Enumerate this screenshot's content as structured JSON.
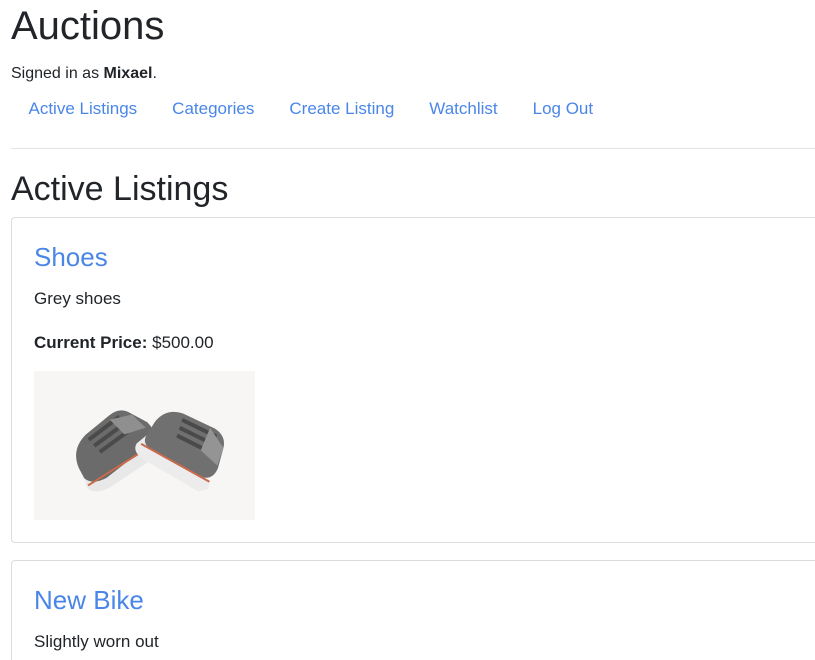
{
  "site": {
    "title": "Auctions",
    "signed_in_prefix": "Signed in as ",
    "username": "Mixael",
    "signed_in_suffix": "."
  },
  "nav": {
    "items": [
      {
        "label": "Active Listings"
      },
      {
        "label": "Categories"
      },
      {
        "label": "Create Listing"
      },
      {
        "label": "Watchlist"
      },
      {
        "label": "Log Out"
      }
    ]
  },
  "main": {
    "heading": "Active Listings",
    "listings": [
      {
        "title": "Shoes",
        "description": "Grey shoes",
        "price_label": "Current Price:",
        "price": "$500.00",
        "image_icon": "sneakers-photo"
      },
      {
        "title": "New Bike",
        "description": "Slightly worn out"
      }
    ]
  },
  "colors": {
    "link": "#4a86e8",
    "text": "#212529",
    "border": "#dcdcdc"
  }
}
